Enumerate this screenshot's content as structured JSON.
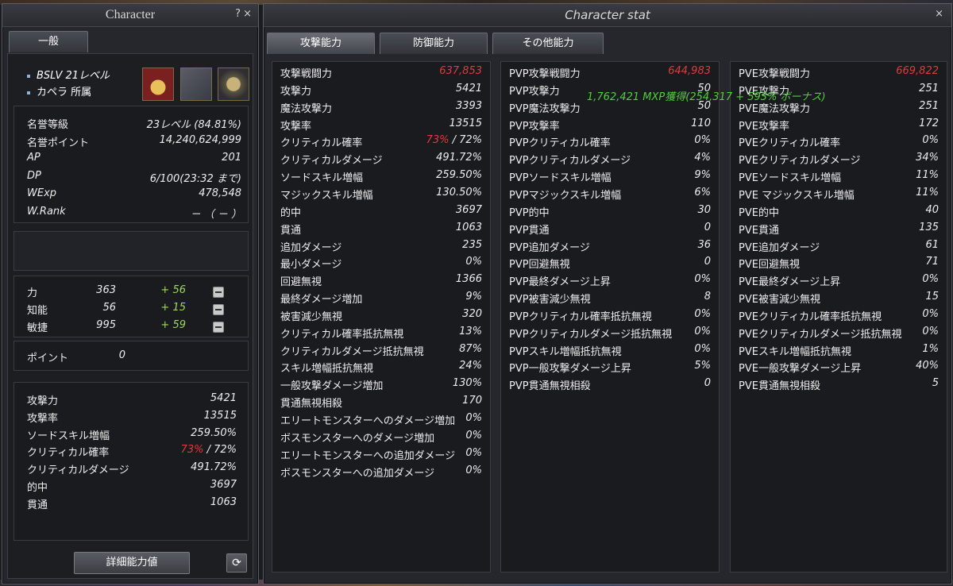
{
  "char": {
    "title": "Character",
    "help": "?",
    "close": "×",
    "tab": "一般",
    "level_line": "BSLV 21レベル",
    "guild_line": "カペラ 所属",
    "honor": [
      {
        "label": "名誉等級",
        "value": "23レベル (84.81%)"
      },
      {
        "label": "名誉ポイント",
        "value": "14,240,624,999"
      },
      {
        "label": "AP",
        "value": "201"
      },
      {
        "label": "DP",
        "value": "6/100(23:32 まで)"
      },
      {
        "label": "WExp",
        "value": "478,548"
      },
      {
        "label": "W.Rank",
        "value": "－ （ － ）"
      }
    ],
    "attrs": [
      {
        "label": "力",
        "base": "363",
        "bonus": "+ 56"
      },
      {
        "label": "知能",
        "base": "56",
        "bonus": "+ 15"
      },
      {
        "label": "敏捷",
        "base": "995",
        "bonus": "+ 59"
      }
    ],
    "points": {
      "label": "ポイント",
      "value": "0"
    },
    "summary": [
      {
        "label": "攻撃力",
        "value": "5421"
      },
      {
        "label": "攻撃率",
        "value": "13515"
      },
      {
        "label": "ソードスキル増幅",
        "value": "259.50%"
      },
      {
        "label": "クリティカル確率",
        "value_red": "73%",
        "value": " / 72%"
      },
      {
        "label": "クリティカルダメージ",
        "value": "491.72%"
      },
      {
        "label": "的中",
        "value": "3697"
      },
      {
        "label": "貫通",
        "value": "1063"
      }
    ],
    "detail_button": "詳細能力値",
    "refresh_icon": "⟳"
  },
  "stat": {
    "title": "Character stat",
    "close": "×",
    "tabs": [
      "攻撃能力",
      "防御能力",
      "その他能力"
    ],
    "overlay": "1,762,421 MXP獲得(254,317 + 593% ボーナス)",
    "col1": [
      {
        "label": "攻撃戦闘力",
        "value": "637,853",
        "red": true
      },
      {
        "label": "攻撃力",
        "value": "5421"
      },
      {
        "label": "魔法攻撃力",
        "value": "3393"
      },
      {
        "label": "攻撃率",
        "value": "13515"
      },
      {
        "label": "クリティカル確率",
        "value_red": "73%",
        "value": " / 72%"
      },
      {
        "label": "クリティカルダメージ",
        "value": "491.72%"
      },
      {
        "label": "ソードスキル増幅",
        "value": "259.50%"
      },
      {
        "label": "マジックスキル増幅",
        "value": "130.50%"
      },
      {
        "label": "的中",
        "value": "3697"
      },
      {
        "label": "貫通",
        "value": "1063"
      },
      {
        "label": "追加ダメージ",
        "value": "235"
      },
      {
        "label": "最小ダメージ",
        "value": "0%"
      },
      {
        "label": "回避無視",
        "value": "1366"
      },
      {
        "label": "最終ダメージ増加",
        "value": "9%"
      },
      {
        "label": "被害減少無視",
        "value": "320"
      },
      {
        "label": "クリティカル確率抵抗無視",
        "value": "13%"
      },
      {
        "label": "クリティカルダメージ抵抗無視",
        "value": "87%"
      },
      {
        "label": "スキル増幅抵抗無視",
        "value": "24%"
      },
      {
        "label": "一般攻撃ダメージ増加",
        "value": "130%"
      },
      {
        "label": "貫通無視相殺",
        "value": "170"
      },
      {
        "label": "エリートモンスターへのダメージ増加",
        "value": "0%"
      },
      {
        "label": "ボスモンスターへのダメージ増加",
        "value": "0%"
      },
      {
        "label": "エリートモンスターへの追加ダメージ",
        "value": "0%"
      },
      {
        "label": "ボスモンスターへの追加ダメージ",
        "value": "0%"
      }
    ],
    "col2": [
      {
        "label": "PVP攻撃戦闘力",
        "value": "644,983",
        "red": true
      },
      {
        "label": "PVP攻撃力",
        "value": "50"
      },
      {
        "label": "PVP魔法攻撃力",
        "value": "50"
      },
      {
        "label": "PVP攻撃率",
        "value": "110"
      },
      {
        "label": "PVPクリティカル確率",
        "value": "0%"
      },
      {
        "label": "PVPクリティカルダメージ",
        "value": "4%"
      },
      {
        "label": "PVPソードスキル増幅",
        "value": "9%"
      },
      {
        "label": "PVPマジックスキル増幅",
        "value": "6%"
      },
      {
        "label": "PVP的中",
        "value": "30"
      },
      {
        "label": "PVP貫通",
        "value": "0"
      },
      {
        "label": "PVP追加ダメージ",
        "value": "36"
      },
      {
        "label": "PVP回避無視",
        "value": "0"
      },
      {
        "label": "PVP最終ダメージ上昇",
        "value": "0%"
      },
      {
        "label": "PVP被害減少無視",
        "value": "8"
      },
      {
        "label": "PVPクリティカル確率抵抗無視",
        "value": "0%"
      },
      {
        "label": "PVPクリティカルダメージ抵抗無視",
        "value": "0%"
      },
      {
        "label": "PVPスキル増幅抵抗無視",
        "value": "0%"
      },
      {
        "label": "PVP一般攻撃ダメージ上昇",
        "value": "5%"
      },
      {
        "label": "PVP貫通無視相殺",
        "value": "0"
      }
    ],
    "col3": [
      {
        "label": "PVE攻撃戦闘力",
        "value": "669,822",
        "red": true
      },
      {
        "label": "PVE攻撃力",
        "value": "251"
      },
      {
        "label": "PVE魔法攻撃力",
        "value": "251"
      },
      {
        "label": "PVE攻撃率",
        "value": "172"
      },
      {
        "label": "PVEクリティカル確率",
        "value": "0%"
      },
      {
        "label": "PVEクリティカルダメージ",
        "value": "34%"
      },
      {
        "label": "PVEソードスキル増幅",
        "value": "11%"
      },
      {
        "label": "PVE マジックスキル増幅",
        "value": "11%"
      },
      {
        "label": "PVE的中",
        "value": "40"
      },
      {
        "label": "PVE貫通",
        "value": "135"
      },
      {
        "label": "PVE追加ダメージ",
        "value": "61"
      },
      {
        "label": "PVE回避無視",
        "value": "71"
      },
      {
        "label": "PVE最終ダメージ上昇",
        "value": "0%"
      },
      {
        "label": "PVE被害減少無視",
        "value": "15"
      },
      {
        "label": "PVEクリティカル確率抵抗無視",
        "value": "0%"
      },
      {
        "label": "PVEクリティカルダメージ抵抗無視",
        "value": "0%"
      },
      {
        "label": "PVEスキル増幅抵抗無視",
        "value": "1%"
      },
      {
        "label": "PVE一般攻撃ダメージ上昇",
        "value": "40%"
      },
      {
        "label": "PVE貫通無視相殺",
        "value": "5"
      }
    ]
  }
}
